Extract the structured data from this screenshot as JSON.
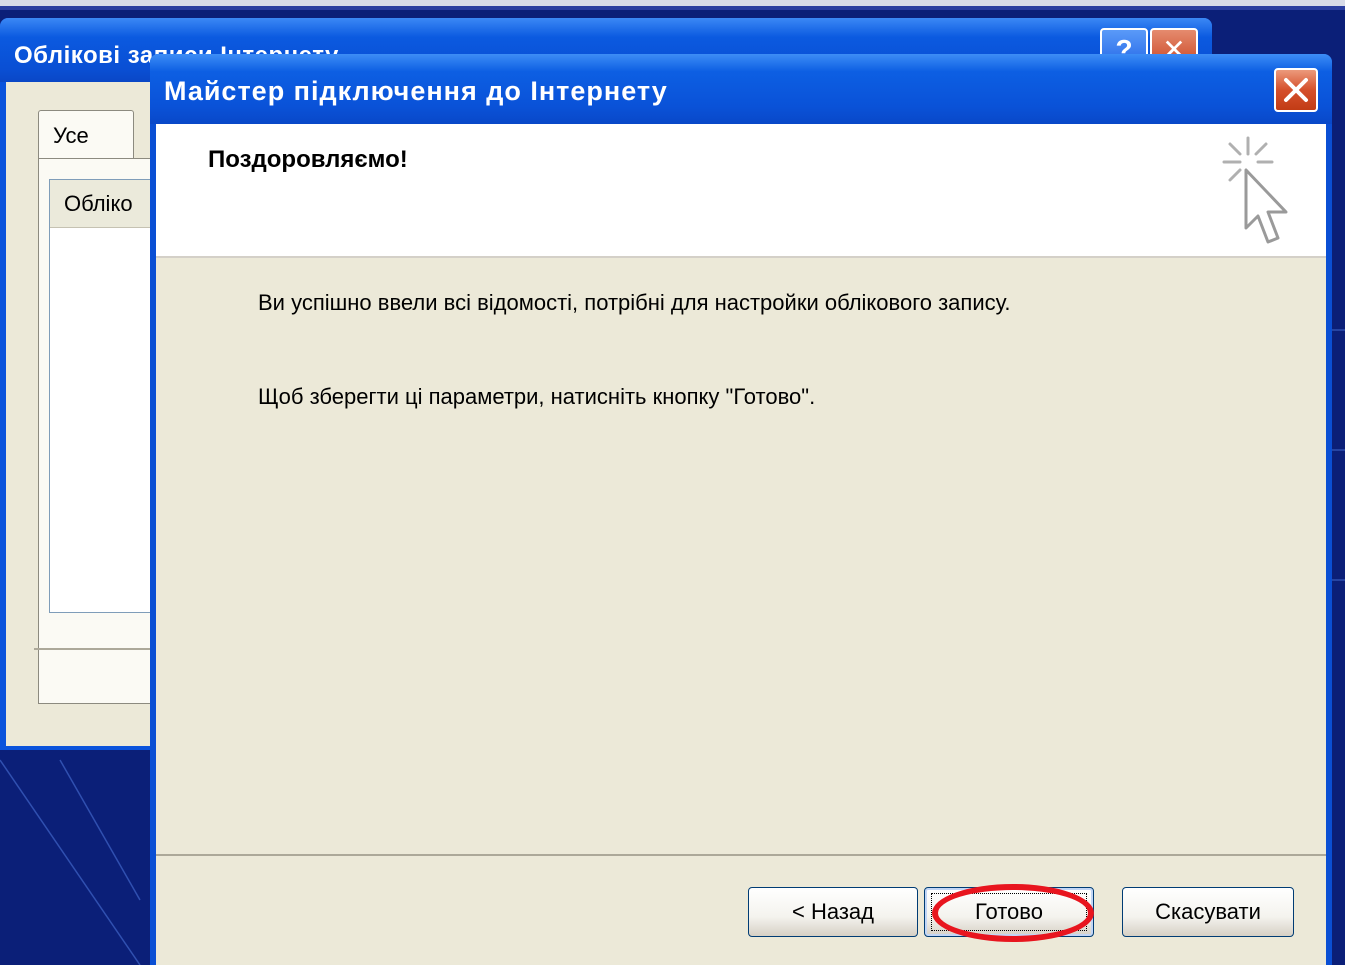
{
  "back_window": {
    "title": "Облікові записи Інтернету",
    "help_label": "?",
    "tab_label": "Усе",
    "list_header": "Обліко"
  },
  "wizard": {
    "title": "Майстер підключення до Інтернету",
    "heading": "Поздоровляємо!",
    "message1": "Ви успішно ввели всі відомості, потрібні для настройки облікового запису.",
    "message2": "Щоб зберегти ці параметри, натисніть кнопку \"Готово\".",
    "buttons": {
      "back": "< Назад",
      "finish": "Готово",
      "cancel": "Скасувати"
    },
    "icon": "wizard-cursor-icon",
    "highlight_color": "#e8151e"
  }
}
